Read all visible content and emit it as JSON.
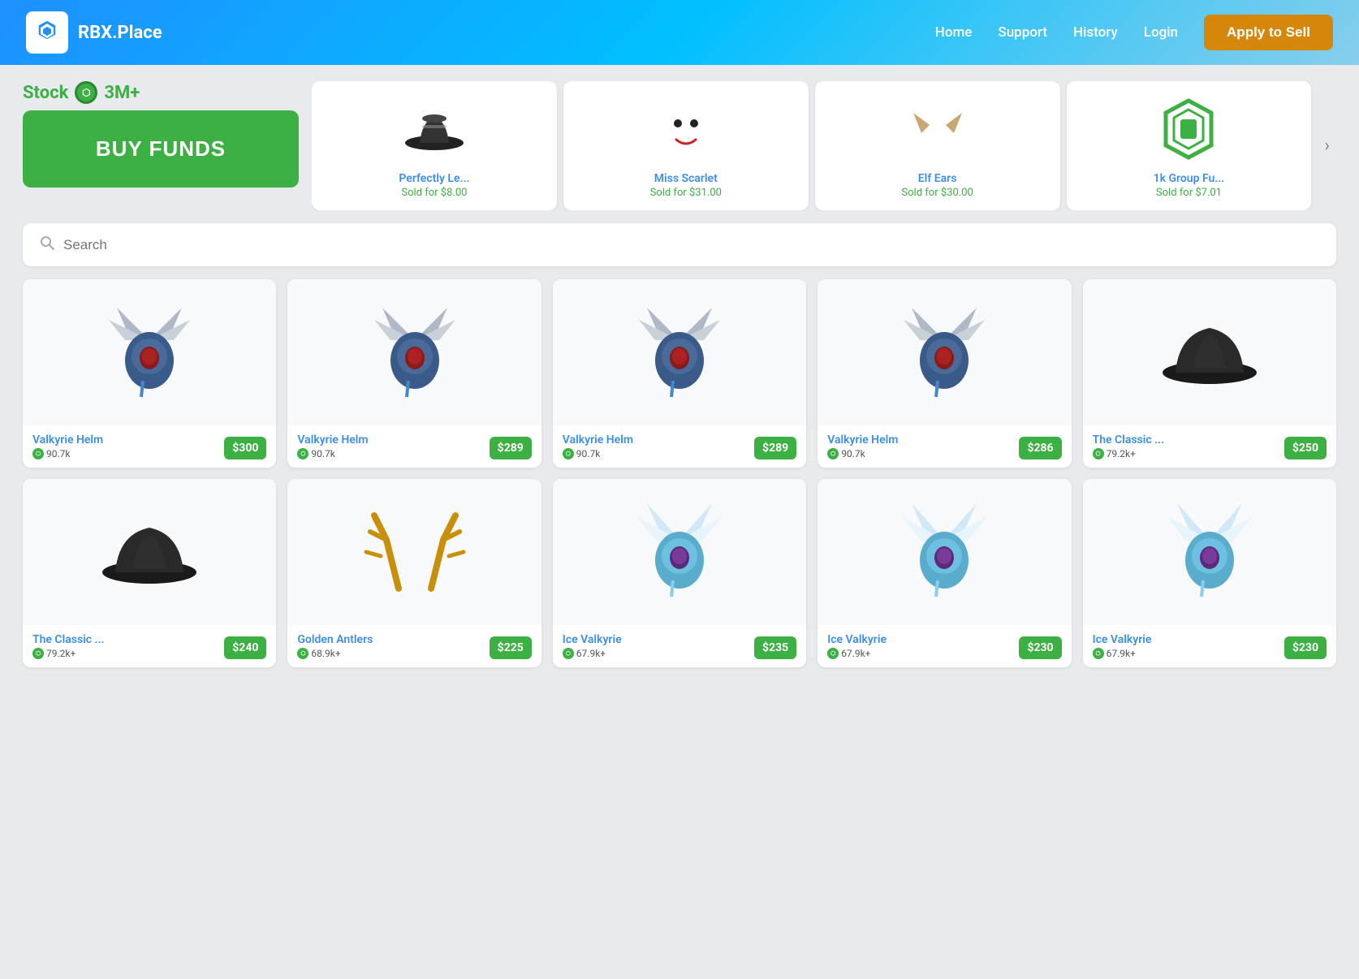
{
  "header": {
    "logo_text": "RBX.Place",
    "nav": {
      "home": "Home",
      "support": "Support",
      "history": "History",
      "login": "Login",
      "apply": "Apply to Sell"
    }
  },
  "stock": {
    "label": "Stock",
    "amount": "3M+",
    "buy_funds_label": "BUY FUNDS"
  },
  "recent_sales": [
    {
      "name": "Perfectly Le...",
      "price": "Sold for $8.00"
    },
    {
      "name": "Miss Scarlet",
      "price": "Sold for $31.00"
    },
    {
      "name": "Elf Ears",
      "price": "Sold for $30.00"
    },
    {
      "name": "1k Group Fu...",
      "price": "Sold for $7.01"
    }
  ],
  "search": {
    "placeholder": "Search"
  },
  "items": [
    {
      "name": "Valkyrie Helm",
      "stock": "90.7k",
      "price": "$300",
      "type": "valkyrie_dark"
    },
    {
      "name": "Valkyrie Helm",
      "stock": "90.7k",
      "price": "$289",
      "type": "valkyrie_dark"
    },
    {
      "name": "Valkyrie Helm",
      "stock": "90.7k",
      "price": "$289",
      "type": "valkyrie_dark"
    },
    {
      "name": "Valkyrie Helm",
      "stock": "90.7k",
      "price": "$286",
      "type": "valkyrie_dark"
    },
    {
      "name": "The Classic ...",
      "stock": "79.2k+",
      "price": "$250",
      "type": "classic_hat"
    },
    {
      "name": "The Classic ...",
      "stock": "79.2k+",
      "price": "$240",
      "type": "classic_hat"
    },
    {
      "name": "Golden Antlers",
      "stock": "68.9k+",
      "price": "$225",
      "type": "antlers"
    },
    {
      "name": "Ice Valkyrie",
      "stock": "67.9k+",
      "price": "$235",
      "type": "ice_valkyrie"
    },
    {
      "name": "Ice Valkyrie",
      "stock": "67.9k+",
      "price": "$230",
      "type": "ice_valkyrie"
    },
    {
      "name": "Ice Valkyrie",
      "stock": "67.9k+",
      "price": "$230",
      "type": "ice_valkyrie"
    }
  ],
  "colors": {
    "green": "#3cb043",
    "blue": "#3b8fe8",
    "orange": "#d4870a",
    "header_start": "#1e90ff",
    "header_end": "#87ceeb"
  }
}
